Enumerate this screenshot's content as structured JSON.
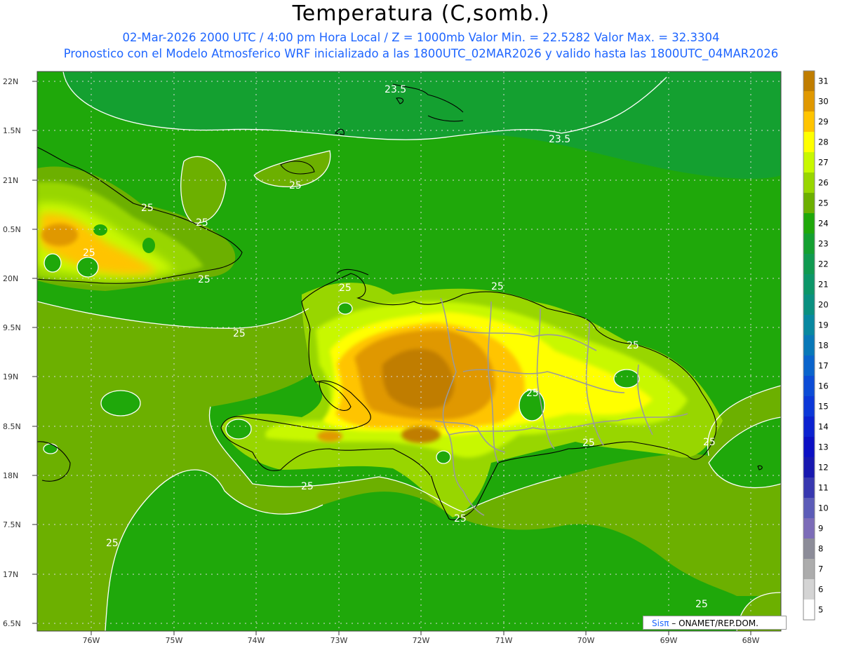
{
  "header": {
    "title": "Temperatura (C,somb.)",
    "line1": "02-Mar-2026  2000 UTC / 4:00 pm Hora Local / Z = 1000mb   Valor Min. = 22.5282  Valor Max. = 32.3304",
    "line2": "Pronostico con el Modelo Atmosferico WRF inicializado a las 1800UTC_02MAR2026 y valido hasta las  1800UTC_04MAR2026"
  },
  "map": {
    "lat_labels": [
      "22N",
      "1.5N",
      "21N",
      "0.5N",
      "20N",
      "9.5N",
      "19N",
      "8.5N",
      "18N",
      "7.5N",
      "17N",
      "6.5N"
    ],
    "lon_labels": [
      "76W",
      "75W",
      "74W",
      "73W",
      "72W",
      "71W",
      "70W",
      "69W",
      "68W"
    ],
    "contour_labels": [
      "23.5",
      "23.5",
      "25",
      "25",
      "25",
      "25",
      "25",
      "25",
      "25",
      "25",
      "25",
      "25",
      "25",
      "25",
      "25",
      "25",
      "25",
      "25"
    ]
  },
  "colorbar": {
    "labels": [
      "31",
      "30",
      "29",
      "28",
      "27",
      "26",
      "25",
      "24",
      "23",
      "22",
      "21",
      "20",
      "19",
      "18",
      "17",
      "16",
      "15",
      "14",
      "13",
      "12",
      "11",
      "10",
      "9",
      "8",
      "7",
      "6",
      "5"
    ],
    "colors": [
      "#c07d00",
      "#e09800",
      "#ffc400",
      "#ffff00",
      "#c8f800",
      "#98d600",
      "#6cb000",
      "#1fa80a",
      "#14a030",
      "#109a50",
      "#0c9668",
      "#0a9080",
      "#0888a0",
      "#0878b8",
      "#0a64cc",
      "#0c4cd6",
      "#0c38d8",
      "#0c22d0",
      "#0c10c4",
      "#1818b0",
      "#3838b0",
      "#5c5cb8",
      "#7c6cb8",
      "#8c8c98",
      "#acacac",
      "#d4d4d4",
      "#ffffff"
    ]
  },
  "credit": {
    "sis": "Sisπ",
    "org": "– ONAMET/REP.DOM."
  }
}
